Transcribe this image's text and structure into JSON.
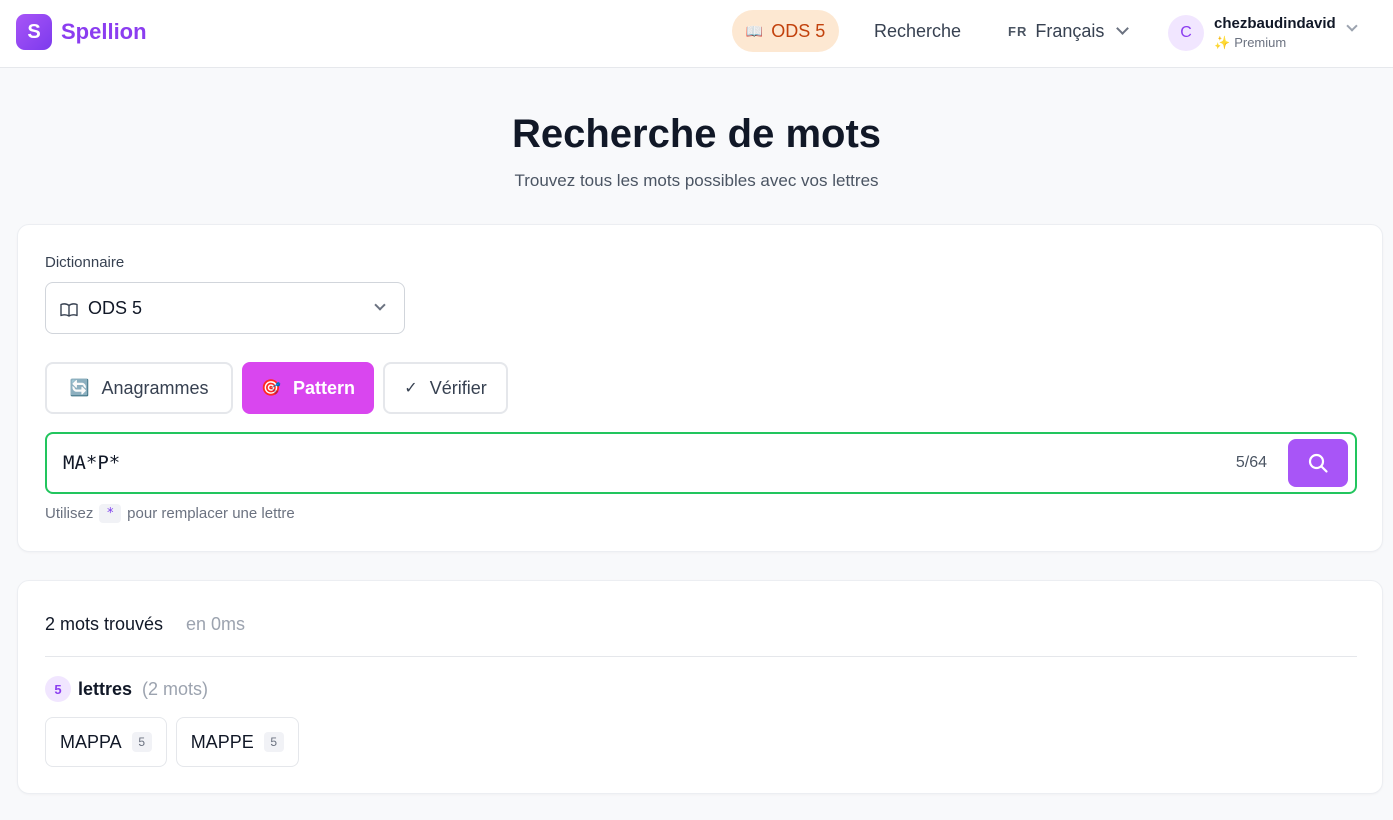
{
  "app": {
    "logo_letter": "S",
    "name": "Spellion"
  },
  "nav": {
    "dictionary_icon": "book-icon",
    "dictionary_label": "ODS 5",
    "search_label": "Recherche",
    "lang_code": "FR",
    "lang_label": "Français"
  },
  "user": {
    "initial": "C",
    "name": "chezbaudindavid",
    "plan_icon": "sparkles-icon",
    "plan": "Premium"
  },
  "page": {
    "title": "Recherche de mots",
    "subtitle": "Trouvez tous les mots possibles avec vos lettres"
  },
  "search": {
    "dictionary_label": "Dictionnaire",
    "dictionary_value": "ODS 5",
    "modes": [
      {
        "label": "Anagrammes",
        "icon": "🔄",
        "active": false
      },
      {
        "label": "Pattern",
        "icon": "🎯",
        "active": true
      },
      {
        "label": "Vérifier",
        "icon": "✓",
        "active": false
      }
    ],
    "input_value": "MA*P*",
    "counter": "5/64",
    "hint_before": "Utilisez",
    "hint_code": "*",
    "hint_after": "pour remplacer une lettre"
  },
  "results": {
    "count_label": "2 mots trouvés",
    "time_label": "en 0ms",
    "groups": [
      {
        "length": "5",
        "label": "lettres",
        "count": "(2 mots)",
        "words": [
          {
            "word": "MAPPA",
            "len": "5"
          },
          {
            "word": "MAPPE",
            "len": "5"
          }
        ]
      }
    ]
  },
  "colors": {
    "brand": "#8b3df0",
    "pattern_active": "#d946ef",
    "search_button": "#a855f7",
    "input_border": "#22c55e",
    "dict_pill_bg": "#fde8d2",
    "dict_pill_text": "#c2410c"
  }
}
